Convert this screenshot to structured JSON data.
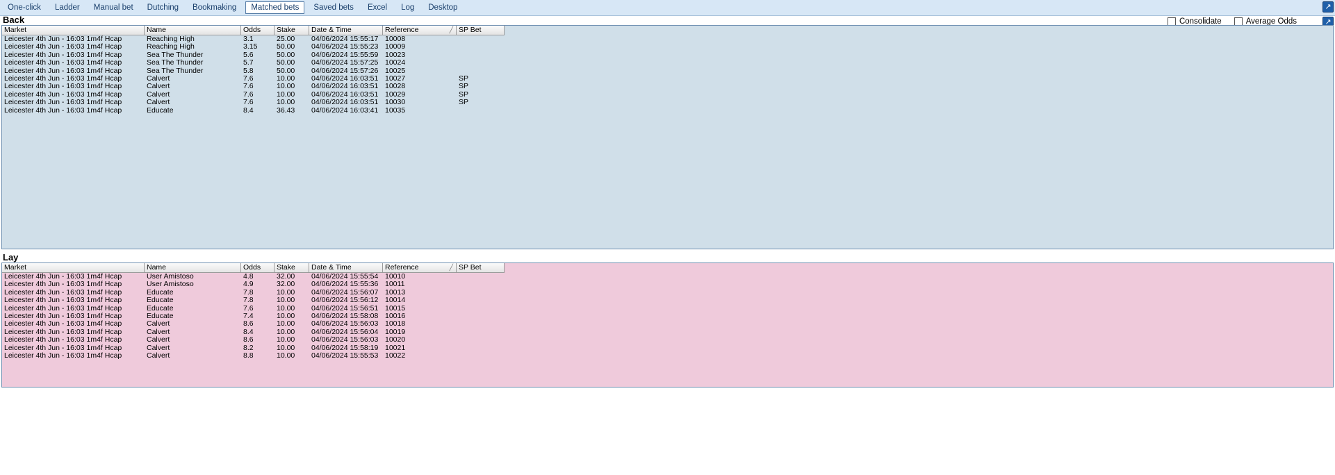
{
  "tabs": [
    "One-click",
    "Ladder",
    "Manual bet",
    "Dutching",
    "Bookmaking",
    "Matched bets",
    "Saved bets",
    "Excel",
    "Log",
    "Desktop"
  ],
  "active_tab": "Matched bets",
  "options": {
    "consolidate_label": "Consolidate",
    "consolidate_checked": false,
    "average_odds_label": "Average Odds",
    "average_odds_checked": false
  },
  "columns": [
    "Market",
    "Name",
    "Odds",
    "Stake",
    "Date & Time",
    "Reference",
    "SP Bet"
  ],
  "back": {
    "title": "Back",
    "background": "#d0dfe9",
    "rows": [
      [
        "Leicester 4th Jun - 16:03 1m4f Hcap",
        "Reaching High",
        "3.1",
        "25.00",
        "04/06/2024 15:55:17",
        "10008",
        ""
      ],
      [
        "Leicester 4th Jun - 16:03 1m4f Hcap",
        "Reaching High",
        "3.15",
        "50.00",
        "04/06/2024 15:55:23",
        "10009",
        ""
      ],
      [
        "Leicester 4th Jun - 16:03 1m4f Hcap",
        "Sea The Thunder",
        "5.6",
        "50.00",
        "04/06/2024 15:55:59",
        "10023",
        ""
      ],
      [
        "Leicester 4th Jun - 16:03 1m4f Hcap",
        "Sea The Thunder",
        "5.7",
        "50.00",
        "04/06/2024 15:57:25",
        "10024",
        ""
      ],
      [
        "Leicester 4th Jun - 16:03 1m4f Hcap",
        "Sea The Thunder",
        "5.8",
        "50.00",
        "04/06/2024 15:57:26",
        "10025",
        ""
      ],
      [
        "Leicester 4th Jun - 16:03 1m4f Hcap",
        "Calvert",
        "7.6",
        "10.00",
        "04/06/2024 16:03:51",
        "10027",
        "SP"
      ],
      [
        "Leicester 4th Jun - 16:03 1m4f Hcap",
        "Calvert",
        "7.6",
        "10.00",
        "04/06/2024 16:03:51",
        "10028",
        "SP"
      ],
      [
        "Leicester 4th Jun - 16:03 1m4f Hcap",
        "Calvert",
        "7.6",
        "10.00",
        "04/06/2024 16:03:51",
        "10029",
        "SP"
      ],
      [
        "Leicester 4th Jun - 16:03 1m4f Hcap",
        "Calvert",
        "7.6",
        "10.00",
        "04/06/2024 16:03:51",
        "10030",
        "SP"
      ],
      [
        "Leicester 4th Jun - 16:03 1m4f Hcap",
        "Educate",
        "8.4",
        "36.43",
        "04/06/2024 16:03:41",
        "10035",
        ""
      ]
    ]
  },
  "lay": {
    "title": "Lay",
    "background": "#efcadb",
    "rows": [
      [
        "Leicester 4th Jun - 16:03 1m4f Hcap",
        "User Amistoso",
        "4.8",
        "32.00",
        "04/06/2024 15:55:54",
        "10010",
        ""
      ],
      [
        "Leicester 4th Jun - 16:03 1m4f Hcap",
        "User Amistoso",
        "4.9",
        "32.00",
        "04/06/2024 15:55:36",
        "10011",
        ""
      ],
      [
        "Leicester 4th Jun - 16:03 1m4f Hcap",
        "Educate",
        "7.8",
        "10.00",
        "04/06/2024 15:56:07",
        "10013",
        ""
      ],
      [
        "Leicester 4th Jun - 16:03 1m4f Hcap",
        "Educate",
        "7.8",
        "10.00",
        "04/06/2024 15:56:12",
        "10014",
        ""
      ],
      [
        "Leicester 4th Jun - 16:03 1m4f Hcap",
        "Educate",
        "7.6",
        "10.00",
        "04/06/2024 15:56:51",
        "10015",
        ""
      ],
      [
        "Leicester 4th Jun - 16:03 1m4f Hcap",
        "Educate",
        "7.4",
        "10.00",
        "04/06/2024 15:58:08",
        "10016",
        ""
      ],
      [
        "Leicester 4th Jun - 16:03 1m4f Hcap",
        "Calvert",
        "8.6",
        "10.00",
        "04/06/2024 15:56:03",
        "10018",
        ""
      ],
      [
        "Leicester 4th Jun - 16:03 1m4f Hcap",
        "Calvert",
        "8.4",
        "10.00",
        "04/06/2024 15:56:04",
        "10019",
        ""
      ],
      [
        "Leicester 4th Jun - 16:03 1m4f Hcap",
        "Calvert",
        "8.6",
        "10.00",
        "04/06/2024 15:56:03",
        "10020",
        ""
      ],
      [
        "Leicester 4th Jun - 16:03 1m4f Hcap",
        "Calvert",
        "8.2",
        "10.00",
        "04/06/2024 15:58:19",
        "10021",
        ""
      ],
      [
        "Leicester 4th Jun - 16:03 1m4f Hcap",
        "Calvert",
        "8.8",
        "10.00",
        "04/06/2024 15:55:53",
        "10022",
        ""
      ]
    ]
  },
  "icons": {
    "popout_top": "popout-arrow-icon",
    "popout_second": "popout-arrow-icon",
    "sort": "sort-indicator-icon"
  }
}
